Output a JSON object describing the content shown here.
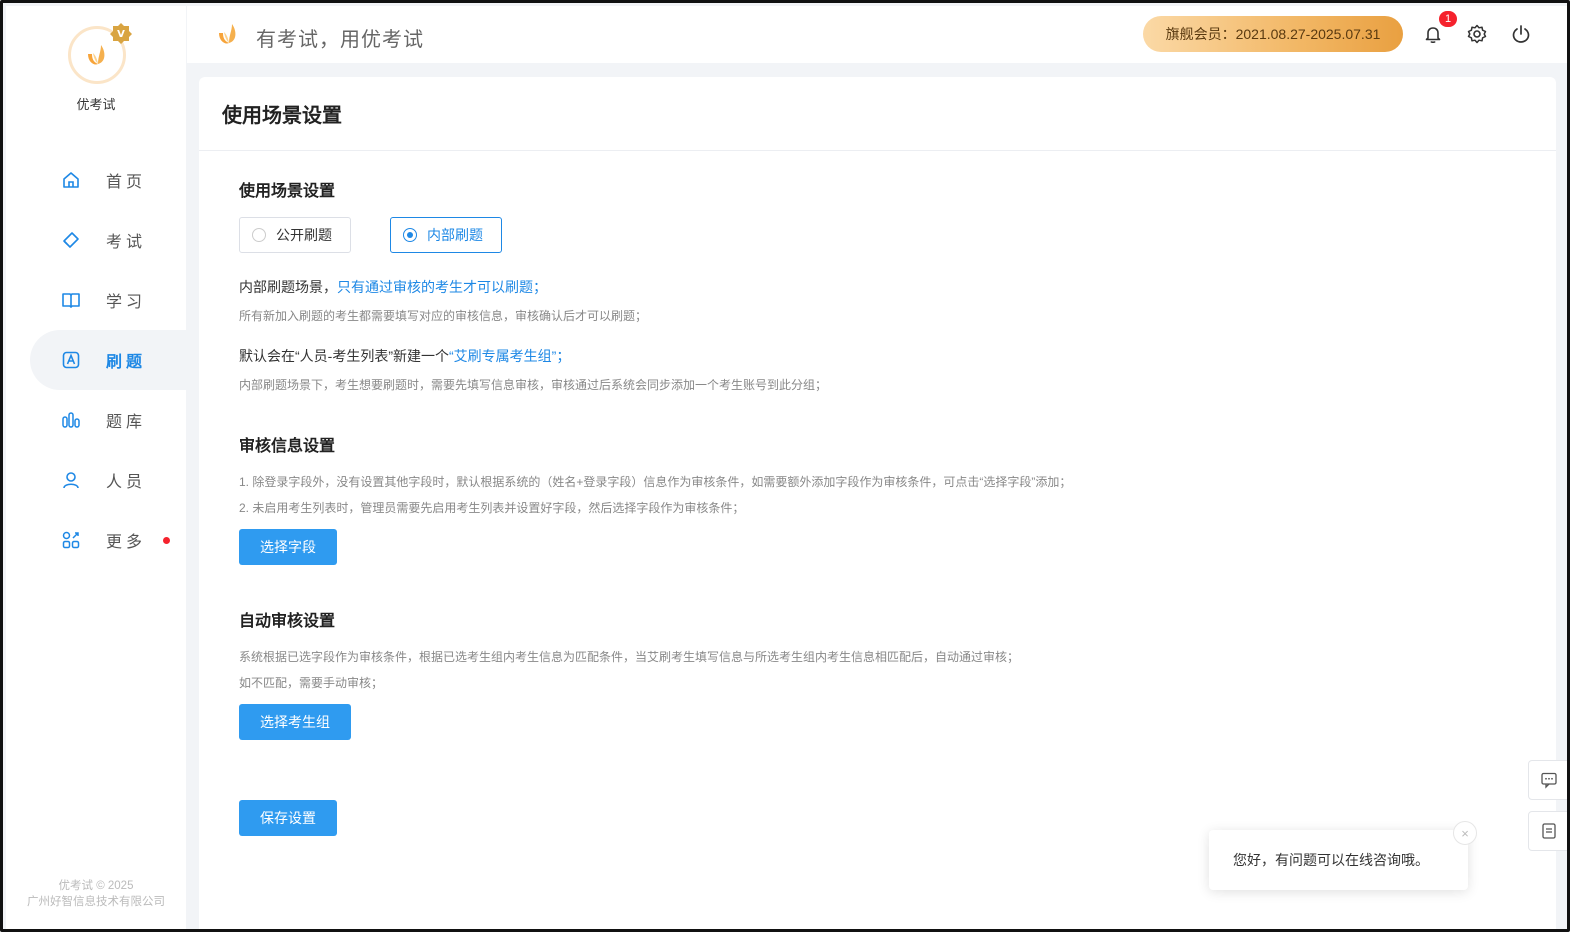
{
  "brand": {
    "name": "优考试"
  },
  "sidebar": {
    "items": [
      {
        "label": "首页",
        "icon": "home-icon"
      },
      {
        "label": "考试",
        "icon": "eraser-icon"
      },
      {
        "label": "学习",
        "icon": "book-icon"
      },
      {
        "label": "刷题",
        "icon": "a-square-icon",
        "active": true
      },
      {
        "label": "题库",
        "icon": "bars-icon"
      },
      {
        "label": "人员",
        "icon": "user-icon"
      },
      {
        "label": "更多",
        "icon": "apps-icon",
        "has_dot": true
      }
    ],
    "footer_line1": "优考试 © 2025",
    "footer_line2": "广州好智信息技术有限公司"
  },
  "header": {
    "slogan": "有考试，用优考试",
    "membership": "旗舰会员：2021.08.27-2025.07.31",
    "notification_count": "1"
  },
  "page": {
    "title": "使用场景设置",
    "scene": {
      "title": "使用场景设置",
      "options": [
        "公开刷题",
        "内部刷题"
      ],
      "selected": "内部刷题",
      "desc1_prefix": "内部刷题场景，",
      "desc1_highlight": "只有通过审核的考生才可以刷题；",
      "desc1_sub": "所有新加入刷题的考生都需要填写对应的审核信息，审核确认后才可以刷题；",
      "desc2_prefix": "默认会在“人员-考生列表”新建一个",
      "desc2_highlight": "“艾刷专属考生组”；",
      "desc2_sub": "内部刷题场景下，考生想要刷题时，需要先填写信息审核，审核通过后系统会同步添加一个考生账号到此分组；"
    },
    "review": {
      "title": "审核信息设置",
      "note1": "1. 除登录字段外，没有设置其他字段时，默认根据系统的（姓名+登录字段）信息作为审核条件，如需要额外添加字段作为审核条件，可点击“选择字段”添加；",
      "note2": "2. 未启用考生列表时，管理员需要先启用考生列表并设置好字段，然后选择字段作为审核条件；",
      "button": "选择字段"
    },
    "auto_review": {
      "title": "自动审核设置",
      "note1": "系统根据已选字段作为审核条件，根据已选考生组内考生信息为匹配条件，当艾刷考生填写信息与所选考生组内考生信息相匹配后，自动通过审核；",
      "note2": "如不匹配，需要手动审核；",
      "button": "选择考生组"
    },
    "save_button": "保存设置"
  },
  "chat": {
    "message": "您好，有问题可以在线咨询哦。",
    "close": "×"
  },
  "colors": {
    "accent": "#1e88e5",
    "button": "#2f9bf0",
    "member_gold": "#f2b765",
    "badge_red": "#f5222d"
  }
}
